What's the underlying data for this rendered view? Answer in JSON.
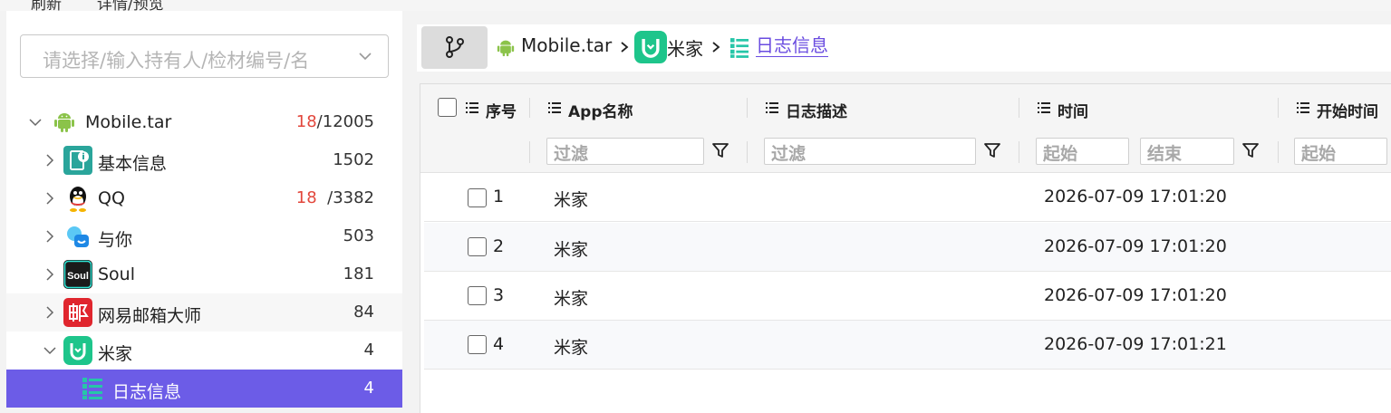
{
  "topbar": {
    "refresh_label": "刷新",
    "details_label": "详情/预览"
  },
  "search": {
    "placeholder": "请选择/输入持有人/检材编号/名"
  },
  "tree": {
    "root": {
      "label": "Mobile.tar",
      "count_highlight": "18",
      "count_total": "/12005"
    },
    "items": [
      {
        "label": "基本信息",
        "count": "1502",
        "icon": "info-card-icon"
      },
      {
        "label": "QQ",
        "count_highlight": "18",
        "count": "/3382",
        "icon": "qq-penguin-icon"
      },
      {
        "label": "与你",
        "count": "503",
        "icon": "yuni-chat-icon"
      },
      {
        "label": "Soul",
        "count": "181",
        "icon": "soul-app-icon"
      },
      {
        "label": "网易邮箱大师",
        "count": "84",
        "icon": "netease-mail-icon"
      },
      {
        "label": "米家",
        "count": "4",
        "icon": "mijia-icon"
      }
    ],
    "selected": {
      "label": "日志信息",
      "count": "4",
      "icon": "log-list-icon"
    }
  },
  "breadcrumb": {
    "root": "Mobile.tar",
    "app": "米家",
    "current": "日志信息"
  },
  "table": {
    "headers": {
      "index": "序号",
      "app_name": "App名称",
      "log_desc": "日志描述",
      "time": "时间",
      "start_time": "开始时间"
    },
    "filters": {
      "filter_placeholder": "过滤",
      "start_placeholder": "起始",
      "end_placeholder": "结束"
    },
    "rows": [
      {
        "index": "1",
        "app_name": "米家",
        "log_desc": "",
        "time": "2026-07-09 17:01:20"
      },
      {
        "index": "2",
        "app_name": "米家",
        "log_desc": "",
        "time": "2026-07-09 17:01:20"
      },
      {
        "index": "3",
        "app_name": "米家",
        "log_desc": "",
        "time": "2026-07-09 17:01:20"
      },
      {
        "index": "4",
        "app_name": "米家",
        "log_desc": "",
        "time": "2026-07-09 17:01:21"
      }
    ]
  },
  "colors": {
    "accent": "#6c5ce7",
    "link": "#6a4ce0",
    "highlight_count": "#e2473c",
    "mijia_green": "#1ec58b"
  }
}
